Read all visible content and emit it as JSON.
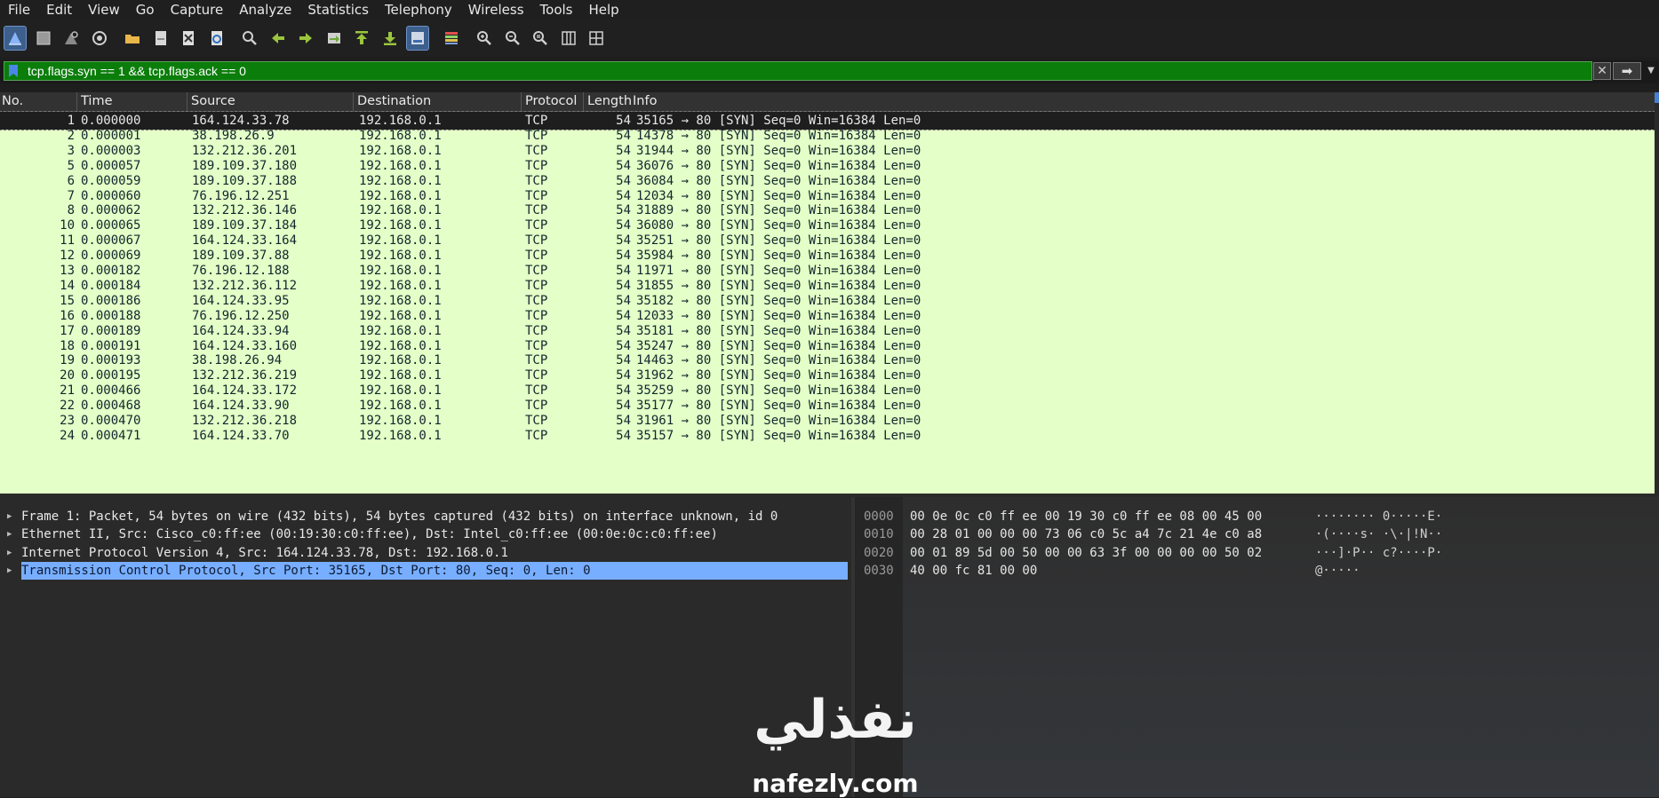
{
  "menu": [
    "File",
    "Edit",
    "View",
    "Go",
    "Capture",
    "Analyze",
    "Statistics",
    "Telephony",
    "Wireless",
    "Tools",
    "Help"
  ],
  "toolbar": {
    "icons": [
      "shark-fin-start-icon",
      "stop-square-icon",
      "restart-fin-icon",
      "capture-options-gear-icon",
      "open-folder-icon",
      "save-file-icon",
      "close-file-icon",
      "reload-file-icon",
      "find-magnifier-icon",
      "go-back-arrow-icon",
      "go-forward-arrow-icon",
      "go-to-packet-icon",
      "go-first-packet-icon",
      "go-last-packet-icon",
      "autoscroll-icon",
      "colorize-icon",
      "zoom-in-icon",
      "zoom-out-icon",
      "zoom-normal-icon",
      "resize-columns-icon",
      "layout-icon"
    ]
  },
  "filter": {
    "text": "tcp.flags.syn == 1 && tcp.flags.ack == 0",
    "bg_color": "#0a7d0a"
  },
  "packet_list": {
    "columns": [
      "No.",
      "Time",
      "Source",
      "Destination",
      "Protocol",
      "Length",
      "Info"
    ],
    "rows": [
      {
        "no": "1",
        "time": "0.000000",
        "src": "164.124.33.78",
        "dst": "192.168.0.1",
        "proto": "TCP",
        "len": "54",
        "info": "35165 → 80 [SYN] Seq=0 Win=16384 Len=0"
      },
      {
        "no": "2",
        "time": "0.000001",
        "src": "38.198.26.9",
        "dst": "192.168.0.1",
        "proto": "TCP",
        "len": "54",
        "info": "14378 → 80 [SYN] Seq=0 Win=16384 Len=0"
      },
      {
        "no": "3",
        "time": "0.000003",
        "src": "132.212.36.201",
        "dst": "192.168.0.1",
        "proto": "TCP",
        "len": "54",
        "info": "31944 → 80 [SYN] Seq=0 Win=16384 Len=0"
      },
      {
        "no": "5",
        "time": "0.000057",
        "src": "189.109.37.180",
        "dst": "192.168.0.1",
        "proto": "TCP",
        "len": "54",
        "info": "36076 → 80 [SYN] Seq=0 Win=16384 Len=0"
      },
      {
        "no": "6",
        "time": "0.000059",
        "src": "189.109.37.188",
        "dst": "192.168.0.1",
        "proto": "TCP",
        "len": "54",
        "info": "36084 → 80 [SYN] Seq=0 Win=16384 Len=0"
      },
      {
        "no": "7",
        "time": "0.000060",
        "src": "76.196.12.251",
        "dst": "192.168.0.1",
        "proto": "TCP",
        "len": "54",
        "info": "12034 → 80 [SYN] Seq=0 Win=16384 Len=0"
      },
      {
        "no": "8",
        "time": "0.000062",
        "src": "132.212.36.146",
        "dst": "192.168.0.1",
        "proto": "TCP",
        "len": "54",
        "info": "31889 → 80 [SYN] Seq=0 Win=16384 Len=0"
      },
      {
        "no": "10",
        "time": "0.000065",
        "src": "189.109.37.184",
        "dst": "192.168.0.1",
        "proto": "TCP",
        "len": "54",
        "info": "36080 → 80 [SYN] Seq=0 Win=16384 Len=0"
      },
      {
        "no": "11",
        "time": "0.000067",
        "src": "164.124.33.164",
        "dst": "192.168.0.1",
        "proto": "TCP",
        "len": "54",
        "info": "35251 → 80 [SYN] Seq=0 Win=16384 Len=0"
      },
      {
        "no": "12",
        "time": "0.000069",
        "src": "189.109.37.88",
        "dst": "192.168.0.1",
        "proto": "TCP",
        "len": "54",
        "info": "35984 → 80 [SYN] Seq=0 Win=16384 Len=0"
      },
      {
        "no": "13",
        "time": "0.000182",
        "src": "76.196.12.188",
        "dst": "192.168.0.1",
        "proto": "TCP",
        "len": "54",
        "info": "11971 → 80 [SYN] Seq=0 Win=16384 Len=0"
      },
      {
        "no": "14",
        "time": "0.000184",
        "src": "132.212.36.112",
        "dst": "192.168.0.1",
        "proto": "TCP",
        "len": "54",
        "info": "31855 → 80 [SYN] Seq=0 Win=16384 Len=0"
      },
      {
        "no": "15",
        "time": "0.000186",
        "src": "164.124.33.95",
        "dst": "192.168.0.1",
        "proto": "TCP",
        "len": "54",
        "info": "35182 → 80 [SYN] Seq=0 Win=16384 Len=0"
      },
      {
        "no": "16",
        "time": "0.000188",
        "src": "76.196.12.250",
        "dst": "192.168.0.1",
        "proto": "TCP",
        "len": "54",
        "info": "12033 → 80 [SYN] Seq=0 Win=16384 Len=0"
      },
      {
        "no": "17",
        "time": "0.000189",
        "src": "164.124.33.94",
        "dst": "192.168.0.1",
        "proto": "TCP",
        "len": "54",
        "info": "35181 → 80 [SYN] Seq=0 Win=16384 Len=0"
      },
      {
        "no": "18",
        "time": "0.000191",
        "src": "164.124.33.160",
        "dst": "192.168.0.1",
        "proto": "TCP",
        "len": "54",
        "info": "35247 → 80 [SYN] Seq=0 Win=16384 Len=0"
      },
      {
        "no": "19",
        "time": "0.000193",
        "src": "38.198.26.94",
        "dst": "192.168.0.1",
        "proto": "TCP",
        "len": "54",
        "info": "14463 → 80 [SYN] Seq=0 Win=16384 Len=0"
      },
      {
        "no": "20",
        "time": "0.000195",
        "src": "132.212.36.219",
        "dst": "192.168.0.1",
        "proto": "TCP",
        "len": "54",
        "info": "31962 → 80 [SYN] Seq=0 Win=16384 Len=0"
      },
      {
        "no": "21",
        "time": "0.000466",
        "src": "164.124.33.172",
        "dst": "192.168.0.1",
        "proto": "TCP",
        "len": "54",
        "info": "35259 → 80 [SYN] Seq=0 Win=16384 Len=0"
      },
      {
        "no": "22",
        "time": "0.000468",
        "src": "164.124.33.90",
        "dst": "192.168.0.1",
        "proto": "TCP",
        "len": "54",
        "info": "35177 → 80 [SYN] Seq=0 Win=16384 Len=0"
      },
      {
        "no": "23",
        "time": "0.000470",
        "src": "132.212.36.218",
        "dst": "192.168.0.1",
        "proto": "TCP",
        "len": "54",
        "info": "31961 → 80 [SYN] Seq=0 Win=16384 Len=0"
      },
      {
        "no": "24",
        "time": "0.000471",
        "src": "164.124.33.70",
        "dst": "192.168.0.1",
        "proto": "TCP",
        "len": "54",
        "info": "35157 → 80 [SYN] Seq=0 Win=16384 Len=0"
      }
    ],
    "row_color": "#e4ffc7"
  },
  "details": {
    "rows": [
      "Frame 1: Packet, 54 bytes on wire (432 bits), 54 bytes captured (432 bits) on interface unknown, id 0",
      "Ethernet II, Src: Cisco_c0:ff:ee (00:19:30:c0:ff:ee), Dst: Intel_c0:ff:ee (00:0e:0c:c0:ff:ee)",
      "Internet Protocol Version 4, Src: 164.124.33.78, Dst: 192.168.0.1",
      "Transmission Control Protocol, Src Port: 35165, Dst Port: 80, Seq: 0, Len: 0"
    ],
    "selected_color": "#78aeff"
  },
  "bytes": {
    "rows": [
      {
        "offset": "0000",
        "hex": "00 0e 0c c0 ff ee 00 19  30 c0 ff ee 08 00 45 00",
        "ascii": "········ 0·····E·"
      },
      {
        "offset": "0010",
        "hex": "00 28 01 00 00 00 73 06  c0 5c a4 7c 21 4e c0 a8",
        "ascii": "·(····s· ·\\·|!N··"
      },
      {
        "offset": "0020",
        "hex": "00 01 89 5d 00 50 00 00  63 3f 00 00 00 00 50 02",
        "ascii": "···]·P·· c?····P·"
      },
      {
        "offset": "0030",
        "hex": "40 00 fc 81 00 00",
        "ascii": "@·····"
      }
    ]
  },
  "watermark": {
    "arabic": "نفذلي",
    "latin": "nafezly.com"
  }
}
